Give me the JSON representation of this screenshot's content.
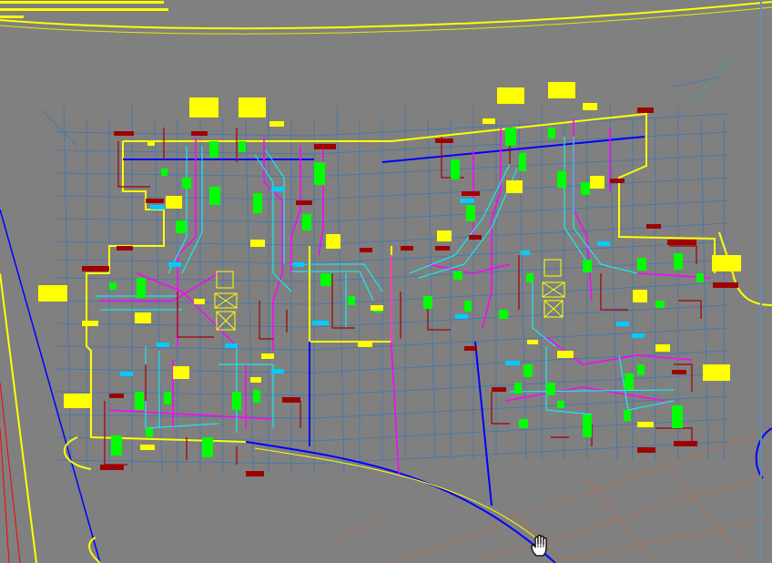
{
  "app": {
    "name": "cad-drawing-viewer",
    "tool": "pan-hand-icon"
  },
  "colors": {
    "background": "#808080",
    "yellow": "#ffff00",
    "magenta": "#ff00ff",
    "cyan": "#00ffff",
    "green": "#00ff00",
    "blue": "#0000ff",
    "dark_red": "#a00000",
    "red": "#ff0000",
    "steel_blue": "#4a78a8",
    "brown": "#b07050",
    "white": "#ffffff"
  }
}
